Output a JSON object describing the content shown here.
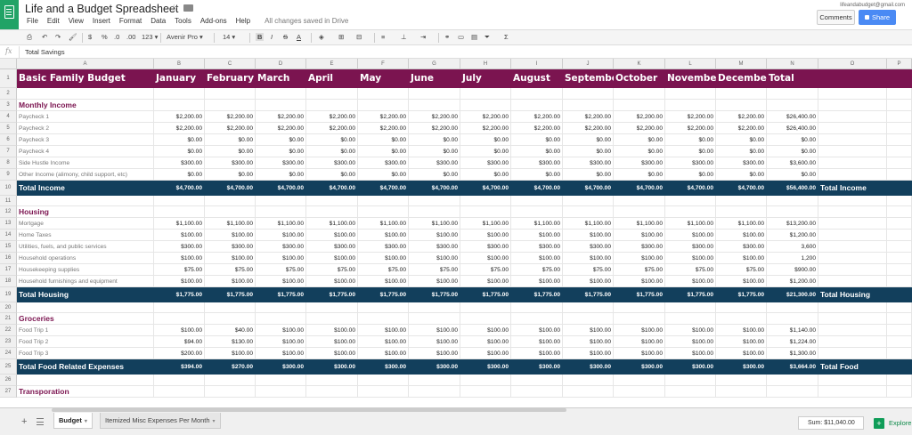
{
  "header": {
    "title": "Life and a Budget Spreadsheet",
    "account_email": "lifeandabudget@gmail.com",
    "comments_label": "Comments",
    "share_label": "Share",
    "save_status": "All changes saved in Drive"
  },
  "menu": [
    "File",
    "Edit",
    "View",
    "Insert",
    "Format",
    "Data",
    "Tools",
    "Add-ons",
    "Help"
  ],
  "toolbar": {
    "currency": "$",
    "percent": "%",
    "decimal_less": ".0",
    "decimal_more": ".00",
    "number_format": "123",
    "font": "Avenir Pro",
    "font_size": "14",
    "bold": "B",
    "italic": "I",
    "strike": "S",
    "text_color": "A"
  },
  "formula_bar": {
    "icon": "fx",
    "value": "Total Savings"
  },
  "columns": [
    "A",
    "B",
    "C",
    "D",
    "E",
    "F",
    "G",
    "H",
    "I",
    "J",
    "K",
    "L",
    "M",
    "N",
    "O",
    "P"
  ],
  "rows": [
    {
      "n": "1",
      "type": "title",
      "cells": [
        "Basic Family Budget",
        "January",
        "February",
        "March",
        "April",
        "May",
        "June",
        "July",
        "August",
        "September",
        "October",
        "November",
        "December",
        "Total"
      ]
    },
    {
      "n": "2",
      "type": "blank"
    },
    {
      "n": "3",
      "type": "section",
      "label": "Monthly Income"
    },
    {
      "n": "4",
      "type": "data",
      "label": "Paycheck 1",
      "cells": [
        "$2,200.00",
        "$2,200.00",
        "$2,200.00",
        "$2,200.00",
        "$2,200.00",
        "$2,200.00",
        "$2,200.00",
        "$2,200.00",
        "$2,200.00",
        "$2,200.00",
        "$2,200.00",
        "$2,200.00",
        "$26,400.00"
      ]
    },
    {
      "n": "5",
      "type": "data",
      "label": "Paycheck 2",
      "cells": [
        "$2,200.00",
        "$2,200.00",
        "$2,200.00",
        "$2,200.00",
        "$2,200.00",
        "$2,200.00",
        "$2,200.00",
        "$2,200.00",
        "$2,200.00",
        "$2,200.00",
        "$2,200.00",
        "$2,200.00",
        "$26,400.00"
      ]
    },
    {
      "n": "6",
      "type": "data",
      "label": "Paycheck 3",
      "cells": [
        "$0.00",
        "$0.00",
        "$0.00",
        "$0.00",
        "$0.00",
        "$0.00",
        "$0.00",
        "$0.00",
        "$0.00",
        "$0.00",
        "$0.00",
        "$0.00",
        "$0.00"
      ]
    },
    {
      "n": "7",
      "type": "data",
      "label": "Paycheck 4",
      "cells": [
        "$0.00",
        "$0.00",
        "$0.00",
        "$0.00",
        "$0.00",
        "$0.00",
        "$0.00",
        "$0.00",
        "$0.00",
        "$0.00",
        "$0.00",
        "$0.00",
        "$0.00"
      ]
    },
    {
      "n": "8",
      "type": "data",
      "label": "Side Hustle Income",
      "cells": [
        "$300.00",
        "$300.00",
        "$300.00",
        "$300.00",
        "$300.00",
        "$300.00",
        "$300.00",
        "$300.00",
        "$300.00",
        "$300.00",
        "$300.00",
        "$300.00",
        "$3,600.00"
      ]
    },
    {
      "n": "9",
      "type": "data",
      "label": "Other Income (alimony, child support, etc)",
      "cells": [
        "$0.00",
        "$0.00",
        "$0.00",
        "$0.00",
        "$0.00",
        "$0.00",
        "$0.00",
        "$0.00",
        "$0.00",
        "$0.00",
        "$0.00",
        "$0.00",
        "$0.00"
      ]
    },
    {
      "n": "10",
      "type": "total",
      "label": "Total Income",
      "cells": [
        "$4,700.00",
        "$4,700.00",
        "$4,700.00",
        "$4,700.00",
        "$4,700.00",
        "$4,700.00",
        "$4,700.00",
        "$4,700.00",
        "$4,700.00",
        "$4,700.00",
        "$4,700.00",
        "$4,700.00",
        "$56,400.00"
      ],
      "extra": "Total Income"
    },
    {
      "n": "11",
      "type": "blank"
    },
    {
      "n": "12",
      "type": "section",
      "label": "Housing"
    },
    {
      "n": "13",
      "type": "data",
      "label": "Mortgage",
      "cells": [
        "$1,100.00",
        "$1,100.00",
        "$1,100.00",
        "$1,100.00",
        "$1,100.00",
        "$1,100.00",
        "$1,100.00",
        "$1,100.00",
        "$1,100.00",
        "$1,100.00",
        "$1,100.00",
        "$1,100.00",
        "$13,200.00"
      ]
    },
    {
      "n": "14",
      "type": "data",
      "label": "Home Taxes",
      "cells": [
        "$100.00",
        "$100.00",
        "$100.00",
        "$100.00",
        "$100.00",
        "$100.00",
        "$100.00",
        "$100.00",
        "$100.00",
        "$100.00",
        "$100.00",
        "$100.00",
        "$1,200.00"
      ]
    },
    {
      "n": "15",
      "type": "data",
      "label": "Utilities, fuels, and public services",
      "cells": [
        "$300.00",
        "$300.00",
        "$300.00",
        "$300.00",
        "$300.00",
        "$300.00",
        "$300.00",
        "$300.00",
        "$300.00",
        "$300.00",
        "$300.00",
        "$300.00",
        "3,600"
      ]
    },
    {
      "n": "16",
      "type": "data",
      "label": "Household operations",
      "cells": [
        "$100.00",
        "$100.00",
        "$100.00",
        "$100.00",
        "$100.00",
        "$100.00",
        "$100.00",
        "$100.00",
        "$100.00",
        "$100.00",
        "$100.00",
        "$100.00",
        "1,200"
      ]
    },
    {
      "n": "17",
      "type": "data",
      "label": "Housekeeping supplies",
      "cells": [
        "$75.00",
        "$75.00",
        "$75.00",
        "$75.00",
        "$75.00",
        "$75.00",
        "$75.00",
        "$75.00",
        "$75.00",
        "$75.00",
        "$75.00",
        "$75.00",
        "$900.00"
      ]
    },
    {
      "n": "18",
      "type": "data",
      "label": "Household furnishings and equipment",
      "cells": [
        "$100.00",
        "$100.00",
        "$100.00",
        "$100.00",
        "$100.00",
        "$100.00",
        "$100.00",
        "$100.00",
        "$100.00",
        "$100.00",
        "$100.00",
        "$100.00",
        "$1,200.00"
      ]
    },
    {
      "n": "19",
      "type": "total",
      "label": "Total Housing",
      "cells": [
        "$1,775.00",
        "$1,775.00",
        "$1,775.00",
        "$1,775.00",
        "$1,775.00",
        "$1,775.00",
        "$1,775.00",
        "$1,775.00",
        "$1,775.00",
        "$1,775.00",
        "$1,775.00",
        "$1,775.00",
        "$21,300.00"
      ],
      "extra": "Total Housing"
    },
    {
      "n": "20",
      "type": "blank"
    },
    {
      "n": "21",
      "type": "section",
      "label": "Groceries"
    },
    {
      "n": "22",
      "type": "data",
      "label": "Food Trip 1",
      "cells": [
        "$100.00",
        "$40.00",
        "$100.00",
        "$100.00",
        "$100.00",
        "$100.00",
        "$100.00",
        "$100.00",
        "$100.00",
        "$100.00",
        "$100.00",
        "$100.00",
        "$1,140.00"
      ]
    },
    {
      "n": "23",
      "type": "data",
      "label": "Food Trip 2",
      "cells": [
        "$94.00",
        "$130.00",
        "$100.00",
        "$100.00",
        "$100.00",
        "$100.00",
        "$100.00",
        "$100.00",
        "$100.00",
        "$100.00",
        "$100.00",
        "$100.00",
        "$1,224.00"
      ]
    },
    {
      "n": "24",
      "type": "data",
      "label": "Food Trip 3",
      "cells": [
        "$200.00",
        "$100.00",
        "$100.00",
        "$100.00",
        "$100.00",
        "$100.00",
        "$100.00",
        "$100.00",
        "$100.00",
        "$100.00",
        "$100.00",
        "$100.00",
        "$1,300.00"
      ]
    },
    {
      "n": "25",
      "type": "total",
      "label": "Total Food Related Expenses",
      "cells": [
        "$394.00",
        "$270.00",
        "$300.00",
        "$300.00",
        "$300.00",
        "$300.00",
        "$300.00",
        "$300.00",
        "$300.00",
        "$300.00",
        "$300.00",
        "$300.00",
        "$3,664.00"
      ],
      "extra": "Total Food"
    },
    {
      "n": "26",
      "type": "blank"
    },
    {
      "n": "27",
      "type": "section",
      "label": "Transporation"
    }
  ],
  "sheets": {
    "tabs": [
      {
        "label": "Budget",
        "active": true
      },
      {
        "label": "Itemized Misc Expenses Per Month",
        "active": false
      }
    ],
    "sum": "Sum: $11,040.00",
    "explore_label": "Explore"
  },
  "colors": {
    "title_band": "#7b1450",
    "total_band": "#123f5c",
    "section_text": "#7b1450",
    "share": "#4a8af4",
    "sheets_green": "#21a366"
  }
}
